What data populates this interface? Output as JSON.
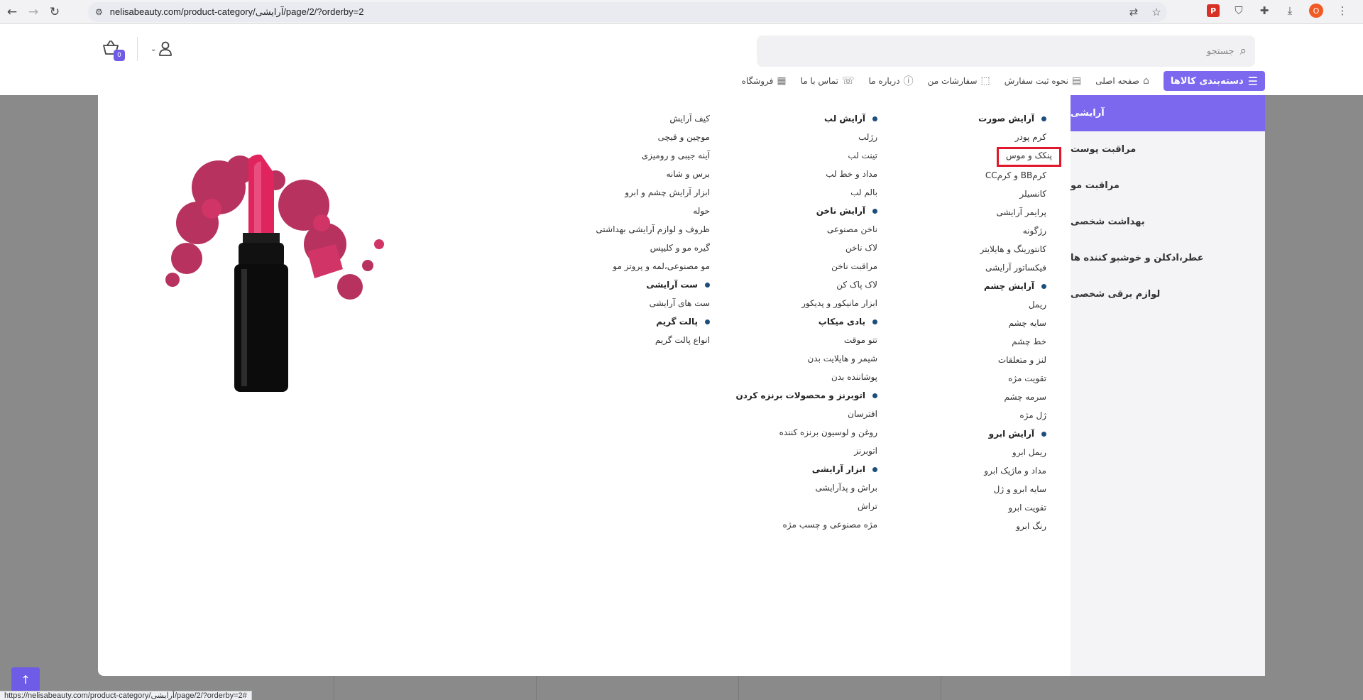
{
  "browser": {
    "url": "nelisabeauty.com/product-category/آرایشی/page/2/?orderby=2",
    "status_url": "https://nelisabeauty.com/product-category/آرایشی/page/2/?orderby=2#",
    "profile_initial": "O",
    "pdf_ext_label": "P"
  },
  "header": {
    "search_placeholder": "جستجو",
    "cart_count": "0"
  },
  "nav": {
    "categories_label": "دسته‌بندی کالاها",
    "links": [
      {
        "label": "صفحه اصلی",
        "icon": "home-icon"
      },
      {
        "label": "نحوه ثبت سفارش",
        "icon": "order-guide-icon"
      },
      {
        "label": "سفارشات من",
        "icon": "box-icon"
      },
      {
        "label": "درباره ما",
        "icon": "info-icon"
      },
      {
        "label": "تماس با ما",
        "icon": "phone-icon"
      },
      {
        "label": "فروشگاه",
        "icon": "shop-icon"
      }
    ]
  },
  "sidebar": {
    "items": [
      {
        "label": "آرایشی",
        "active": true
      },
      {
        "label": "مراقبت پوست"
      },
      {
        "label": "مراقبت مو"
      },
      {
        "label": "بهداشت شخصی"
      },
      {
        "label": "عطر،ادکلن و خوشبو کننده ها"
      },
      {
        "label": "لوازم برقی شخصی"
      }
    ]
  },
  "menu": {
    "col1": [
      {
        "label": "آرایش صورت",
        "heading": true
      },
      {
        "label": "کرم پودر"
      },
      {
        "label": "پنکک و موس",
        "highlighted": true
      },
      {
        "label": "کرمBB و کرمCC"
      },
      {
        "label": "کانسیلر"
      },
      {
        "label": "پرایمر آرایشی"
      },
      {
        "label": "رژگونه"
      },
      {
        "label": "کانتورینگ و هایلایتر"
      },
      {
        "label": "فیکساتور آرایشی"
      },
      {
        "label": "آرایش چشم",
        "heading": true
      },
      {
        "label": "ریمل"
      },
      {
        "label": "سایه چشم"
      },
      {
        "label": "خط چشم"
      },
      {
        "label": "لنز و متعلقات"
      },
      {
        "label": "تقویت مژه"
      },
      {
        "label": "سرمه چشم"
      },
      {
        "label": "ژل مژه"
      },
      {
        "label": "آرایش ابرو",
        "heading": true
      },
      {
        "label": "ریمل ابرو"
      },
      {
        "label": "مداد و ماژیک ابرو"
      },
      {
        "label": "سایه ابرو و ژل"
      },
      {
        "label": "تقویت ابرو"
      },
      {
        "label": "رنگ ابرو"
      }
    ],
    "col2": [
      {
        "label": "آرایش لب",
        "heading": true
      },
      {
        "label": "رژلب"
      },
      {
        "label": "تینت لب"
      },
      {
        "label": "مداد و خط لب"
      },
      {
        "label": "بالم لب"
      },
      {
        "label": "آرایش ناخن",
        "heading": true
      },
      {
        "label": "ناخن مصنوعی"
      },
      {
        "label": "لاک ناخن"
      },
      {
        "label": "مراقبت ناخن"
      },
      {
        "label": "لاک پاک کن"
      },
      {
        "label": "ابزار مانیکور و پدیکور"
      },
      {
        "label": "بادی میکاپ",
        "heading": true
      },
      {
        "label": "تتو موقت"
      },
      {
        "label": "شیمر و هایلایت بدن"
      },
      {
        "label": "پوشاننده بدن"
      },
      {
        "label": "اتوبرنز و محصولات برنزه کردن",
        "heading": true
      },
      {
        "label": "افترسان"
      },
      {
        "label": "روغن و لوسیون برنزه کننده"
      },
      {
        "label": "اتوبرنز"
      },
      {
        "label": "ابزار آرایشی",
        "heading": true
      },
      {
        "label": "براش و پدآرایشی"
      },
      {
        "label": "تراش"
      },
      {
        "label": "مژه مصنوعی و چسب مژه"
      }
    ],
    "col3": [
      {
        "label": "کیف آرایش"
      },
      {
        "label": "موچین و قیچی"
      },
      {
        "label": "آینه جیبی و رومیزی"
      },
      {
        "label": "برس و شانه"
      },
      {
        "label": "ابزار آرایش چشم و ابرو"
      },
      {
        "label": "حوله"
      },
      {
        "label": "ظروف و لوازم آرایشی بهداشتی"
      },
      {
        "label": "گیره مو و کلیپس"
      },
      {
        "label": "مو مصنوعی،لمه و پروتز مو"
      },
      {
        "label": "ست آرایشی",
        "heading": true
      },
      {
        "label": "ست های آرایشی"
      },
      {
        "label": "پالت گریم",
        "heading": true
      },
      {
        "label": "انواع پالت گریم"
      }
    ]
  },
  "colors": {
    "accent": "#7b68ee",
    "bullet": "#1e4e7a",
    "highlight_box": "#e0182d",
    "lipstick": "#e0245e"
  }
}
